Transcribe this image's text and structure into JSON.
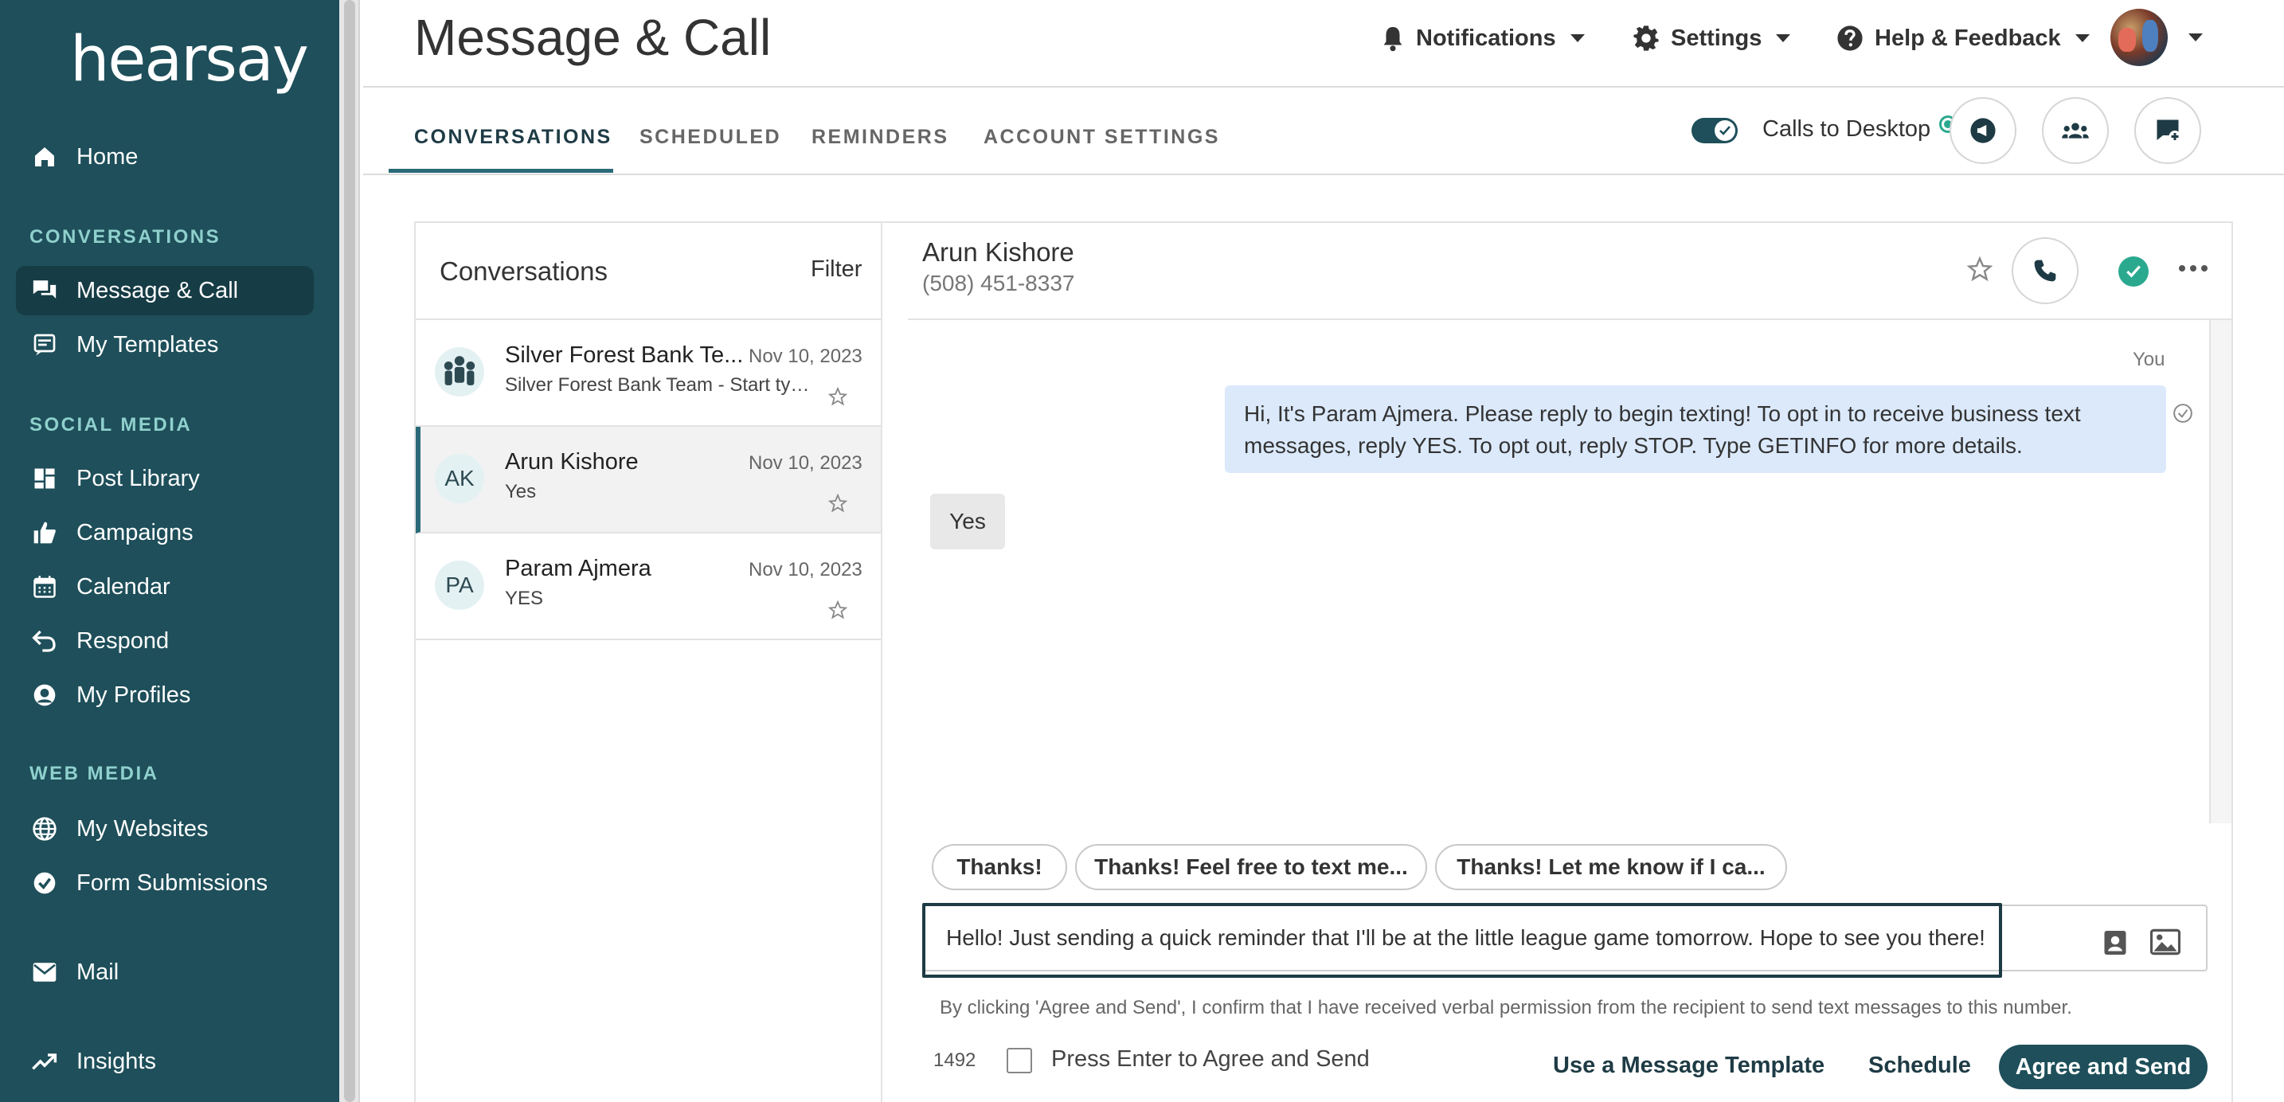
{
  "app": {
    "logo": "hearsay"
  },
  "sidebar": {
    "home": "Home",
    "sections": {
      "conversations": "CONVERSATIONS",
      "social_media": "SOCIAL MEDIA",
      "web_media": "WEB MEDIA"
    },
    "conversations_items": [
      {
        "label": "Message & Call",
        "icon": "chat-bubbles-icon",
        "active": true
      },
      {
        "label": "My Templates",
        "icon": "template-icon"
      }
    ],
    "social_items": [
      {
        "label": "Post Library",
        "icon": "grid-icon"
      },
      {
        "label": "Campaigns",
        "icon": "thumbs-up-icon"
      },
      {
        "label": "Calendar",
        "icon": "calendar-icon"
      },
      {
        "label": "Respond",
        "icon": "reply-icon"
      },
      {
        "label": "My Profiles",
        "icon": "profile-icon"
      }
    ],
    "web_items": [
      {
        "label": "My Websites",
        "icon": "globe-icon"
      },
      {
        "label": "Form Submissions",
        "icon": "check-circle-icon"
      }
    ],
    "mail": "Mail",
    "insights": "Insights"
  },
  "header": {
    "title": "Message & Call",
    "notifications": "Notifications",
    "settings": "Settings",
    "help": "Help & Feedback"
  },
  "tabs": {
    "conversations": "CONVERSATIONS",
    "scheduled": "SCHEDULED",
    "reminders": "REMINDERS",
    "account_settings": "ACCOUNT SETTINGS",
    "calls_to_desktop": "Calls to Desktop",
    "calls_to_desktop_enabled": true
  },
  "list": {
    "title": "Conversations",
    "filter": "Filter",
    "items": [
      {
        "initials": "",
        "name": "Silver Forest Bank Te...",
        "date": "Nov 10, 2023",
        "preview": "Silver Forest Bank Team - Start typi...",
        "group": true
      },
      {
        "initials": "AK",
        "name": "Arun Kishore",
        "date": "Nov 10, 2023",
        "preview": "Yes",
        "active": true
      },
      {
        "initials": "PA",
        "name": "Param Ajmera",
        "date": "Nov 10, 2023",
        "preview": "YES"
      }
    ]
  },
  "chat": {
    "name": "Arun Kishore",
    "phone": "(508) 451-8337",
    "you_label": "You",
    "outgoing_line1": "Hi, It's Param Ajmera. Please reply to begin texting! To opt in to receive business text",
    "outgoing_line2": "messages, reply YES. To opt out, reply STOP. Type GETINFO for more details.",
    "incoming": "Yes",
    "chips": [
      "Thanks!",
      "Thanks! Feel free to text me...",
      "Thanks! Let me know if I ca..."
    ],
    "composer_text": "Hello! Just sending a quick reminder that I'll be at the little league game tomorrow. Hope to see you there!",
    "consent": "By clicking 'Agree and Send', I confirm that I have received verbal permission from the recipient to send text messages to this number.",
    "char_count": "1492",
    "enter_label": "Press Enter to Agree and Send",
    "use_template": "Use a Message Template",
    "schedule": "Schedule",
    "agree_send": "Agree and Send"
  },
  "colors": {
    "sidebar": "#1e4f5a",
    "accent": "#2a6a78",
    "teal": "#2aa98f",
    "bubble_out": "#dbe9fb"
  }
}
